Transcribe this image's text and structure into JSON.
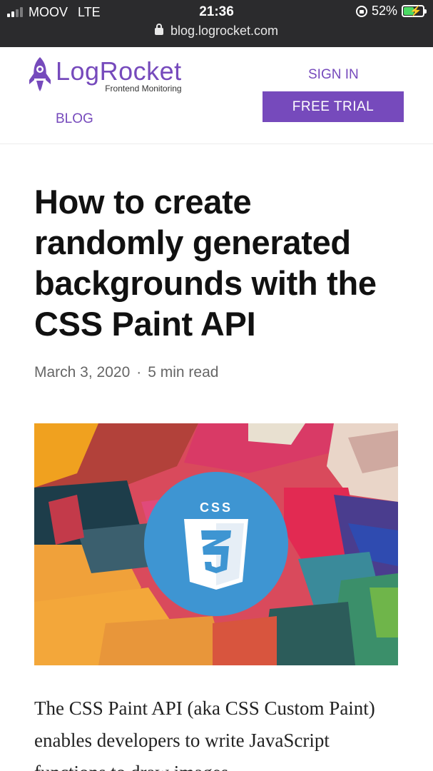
{
  "status_bar": {
    "carrier": "MOOV",
    "network": "LTE",
    "time": "21:36",
    "battery": "52%",
    "battery_level": 0.52,
    "url": "blog.logrocket.com"
  },
  "header": {
    "logo_text": "LogRocket",
    "logo_subtitle": "Frontend Monitoring",
    "blog_link": "BLOG",
    "signin_link": "SIGN IN",
    "trial_button": "FREE TRIAL",
    "brand_color": "#764abc"
  },
  "article": {
    "title": "How to create randomly generated backgrounds with the CSS Paint API",
    "date": "March 3, 2020",
    "separator": "·",
    "read_time": "5 min read",
    "hero_image": {
      "badge_text": "CSS",
      "shield_number": "3",
      "badge_color": "#3e95d2"
    },
    "intro": "The CSS Paint API (aka CSS Custom Paint) enables developers to write JavaScript functions to draw images"
  }
}
